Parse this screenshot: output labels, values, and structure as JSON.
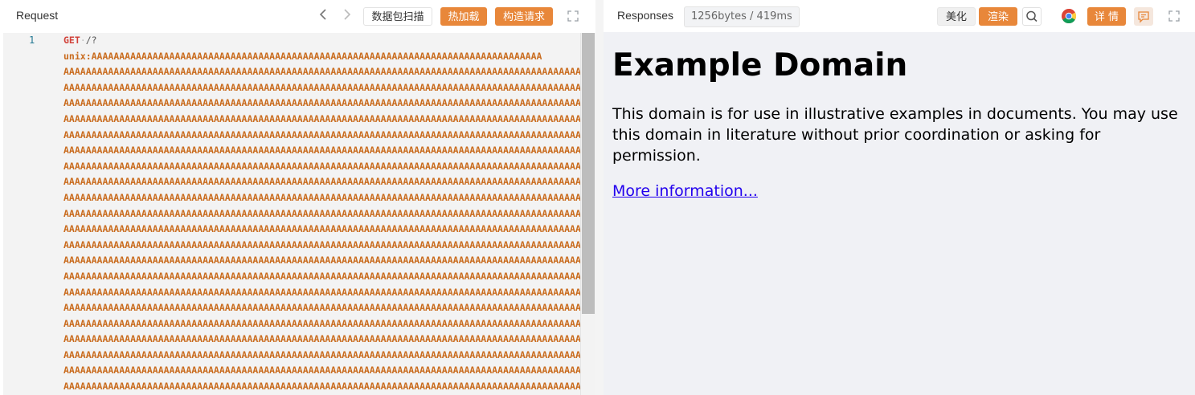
{
  "request": {
    "title": "Request",
    "toolbar": {
      "scan_label": "数据包扫描",
      "hot_load_label": "热加载",
      "build_request_label": "构造请求"
    },
    "line_numbers": [
      "1"
    ],
    "method": "GET",
    "path": "/?",
    "body_prefix": "unix:",
    "body_first": "AAAAAAAAAAAAAAAAAAAAAAAAAAAAAAAAAAAAAAAAAAAAAAAAAAAAAAAAAAAAAAAAAAAAAAAAAAAAAAAAA",
    "body_line": "AAAAAAAAAAAAAAAAAAAAAAAAAAAAAAAAAAAAAAAAAAAAAAAAAAAAAAAAAAAAAAAAAAAAAAAAAAAAAAAAAAAAAAAAAAAAA"
  },
  "response": {
    "title": "Responses",
    "stats": "1256bytes / 419ms",
    "toolbar": {
      "beautify_label": "美化",
      "render_label": "渲染",
      "details_label": "详 情"
    },
    "rendered": {
      "heading": "Example Domain",
      "paragraph": "This domain is for use in illustrative examples in documents. You may use this domain in literature without prior coordination or asking for permission.",
      "link": "More information..."
    }
  },
  "icons": {
    "prev": "chevron-left-icon",
    "next": "chevron-right-icon",
    "fullscreen": "expand-icon",
    "search": "search-icon",
    "browser": "chrome-icon",
    "comment": "comment-icon"
  },
  "colors": {
    "accent": "#e8873a",
    "method": "#d1423a",
    "code_text": "#c96b1d",
    "link": "#2200ee",
    "response_bg": "#f0f1f5"
  }
}
